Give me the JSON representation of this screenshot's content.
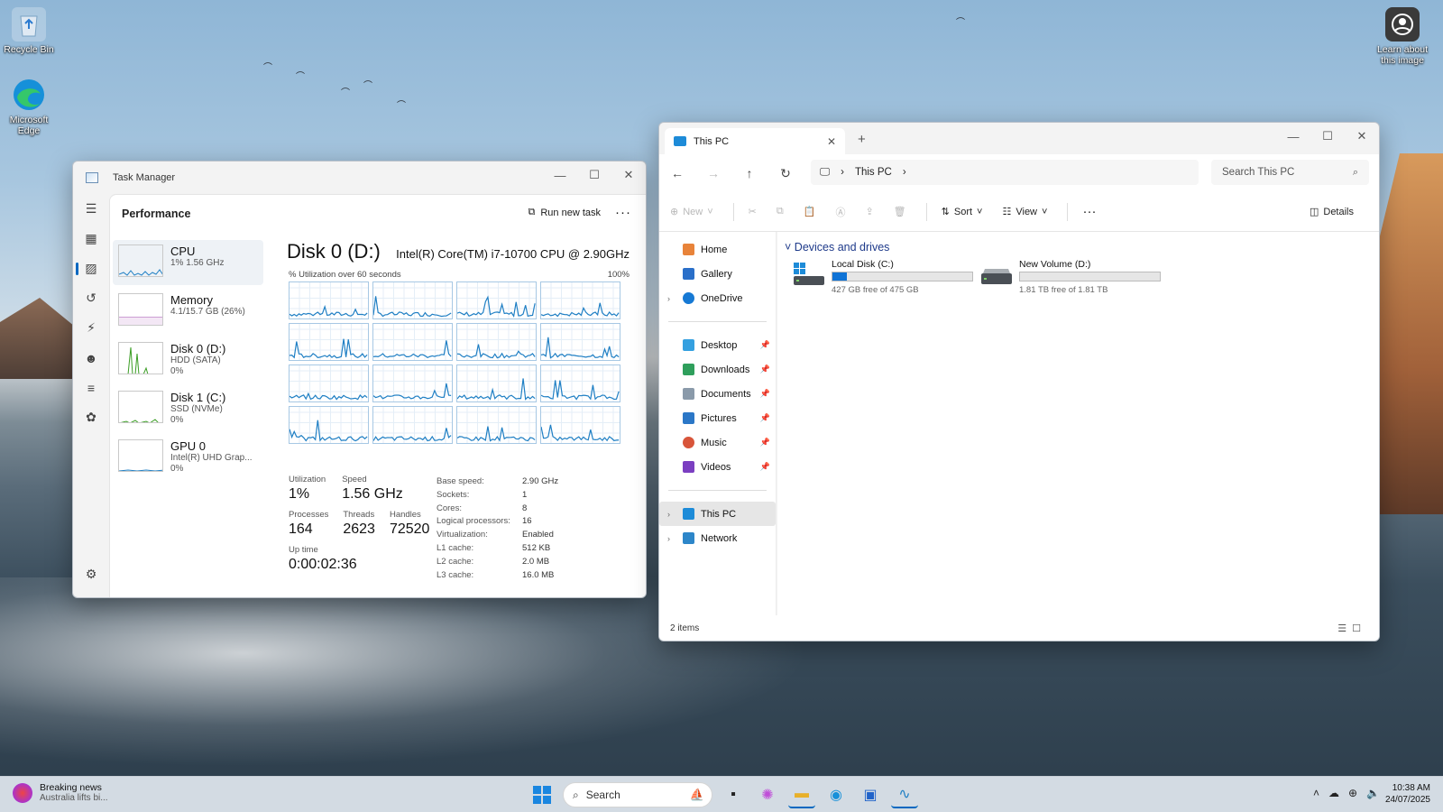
{
  "desktop": {
    "icons": [
      {
        "label": "Recycle Bin"
      },
      {
        "label": "Microsoft Edge"
      },
      {
        "label": "Learn about this image"
      }
    ]
  },
  "task_manager": {
    "title": "Task Manager",
    "section": "Performance",
    "run_new_task": "Run new task",
    "items": [
      {
        "name": "CPU",
        "sub1": "1% 1.56 GHz",
        "sub2": ""
      },
      {
        "name": "Memory",
        "sub1": "4.1/15.7 GB (26%)",
        "sub2": ""
      },
      {
        "name": "Disk 0 (D:)",
        "sub1": "HDD (SATA)",
        "sub2": "0%"
      },
      {
        "name": "Disk 1 (C:)",
        "sub1": "SSD (NVMe)",
        "sub2": "0%"
      },
      {
        "name": "GPU 0",
        "sub1": "Intel(R) UHD Grap...",
        "sub2": "0%"
      }
    ],
    "detail": {
      "title": "Disk 0 (D:)",
      "model": "Intel(R) Core(TM) i7-10700 CPU @ 2.90GHz",
      "util_label": "% Utilization over 60 seconds",
      "util_max": "100%",
      "utilization_label": "Utilization",
      "utilization": "1%",
      "speed_label": "Speed",
      "speed": "1.56 GHz",
      "processes_label": "Processes",
      "processes": "164",
      "threads_label": "Threads",
      "threads": "2623",
      "handles_label": "Handles",
      "handles": "72520",
      "uptime_label": "Up time",
      "uptime": "0:00:02:36",
      "specs": [
        {
          "k": "Base speed:",
          "v": "2.90 GHz"
        },
        {
          "k": "Sockets:",
          "v": "1"
        },
        {
          "k": "Cores:",
          "v": "8"
        },
        {
          "k": "Logical processors:",
          "v": "16"
        },
        {
          "k": "Virtualization:",
          "v": "Enabled"
        },
        {
          "k": "L1 cache:",
          "v": "512 KB"
        },
        {
          "k": "L2 cache:",
          "v": "2.0 MB"
        },
        {
          "k": "L3 cache:",
          "v": "16.0 MB"
        }
      ]
    }
  },
  "explorer": {
    "tab_title": "This PC",
    "address": "This PC",
    "search_placeholder": "Search This PC",
    "cmd": {
      "new": "New",
      "sort": "Sort",
      "view": "View",
      "details": "Details"
    },
    "sidebar": [
      {
        "label": "Home"
      },
      {
        "label": "Gallery"
      },
      {
        "label": "OneDrive"
      },
      {
        "label": "Desktop"
      },
      {
        "label": "Downloads"
      },
      {
        "label": "Documents"
      },
      {
        "label": "Pictures"
      },
      {
        "label": "Music"
      },
      {
        "label": "Videos"
      },
      {
        "label": "This PC"
      },
      {
        "label": "Network"
      }
    ],
    "group": "Devices and drives",
    "drives": [
      {
        "name": "Local Disk (C:)",
        "free": "427 GB free of 475 GB",
        "used_fraction": 0.1
      },
      {
        "name": "New Volume (D:)",
        "free": "1.81 TB free of 1.81 TB",
        "used_fraction": 0.0
      }
    ],
    "status": "2 items"
  },
  "taskbar": {
    "news_title": "Breaking news",
    "news_sub": "Australia lifts bi...",
    "search": "Search",
    "time": "10:38 AM",
    "date": "24/07/2025"
  },
  "colors": {
    "accent": "#0067c0",
    "graph": "#1f7fc4",
    "drive_fill": "#0f73d6"
  }
}
